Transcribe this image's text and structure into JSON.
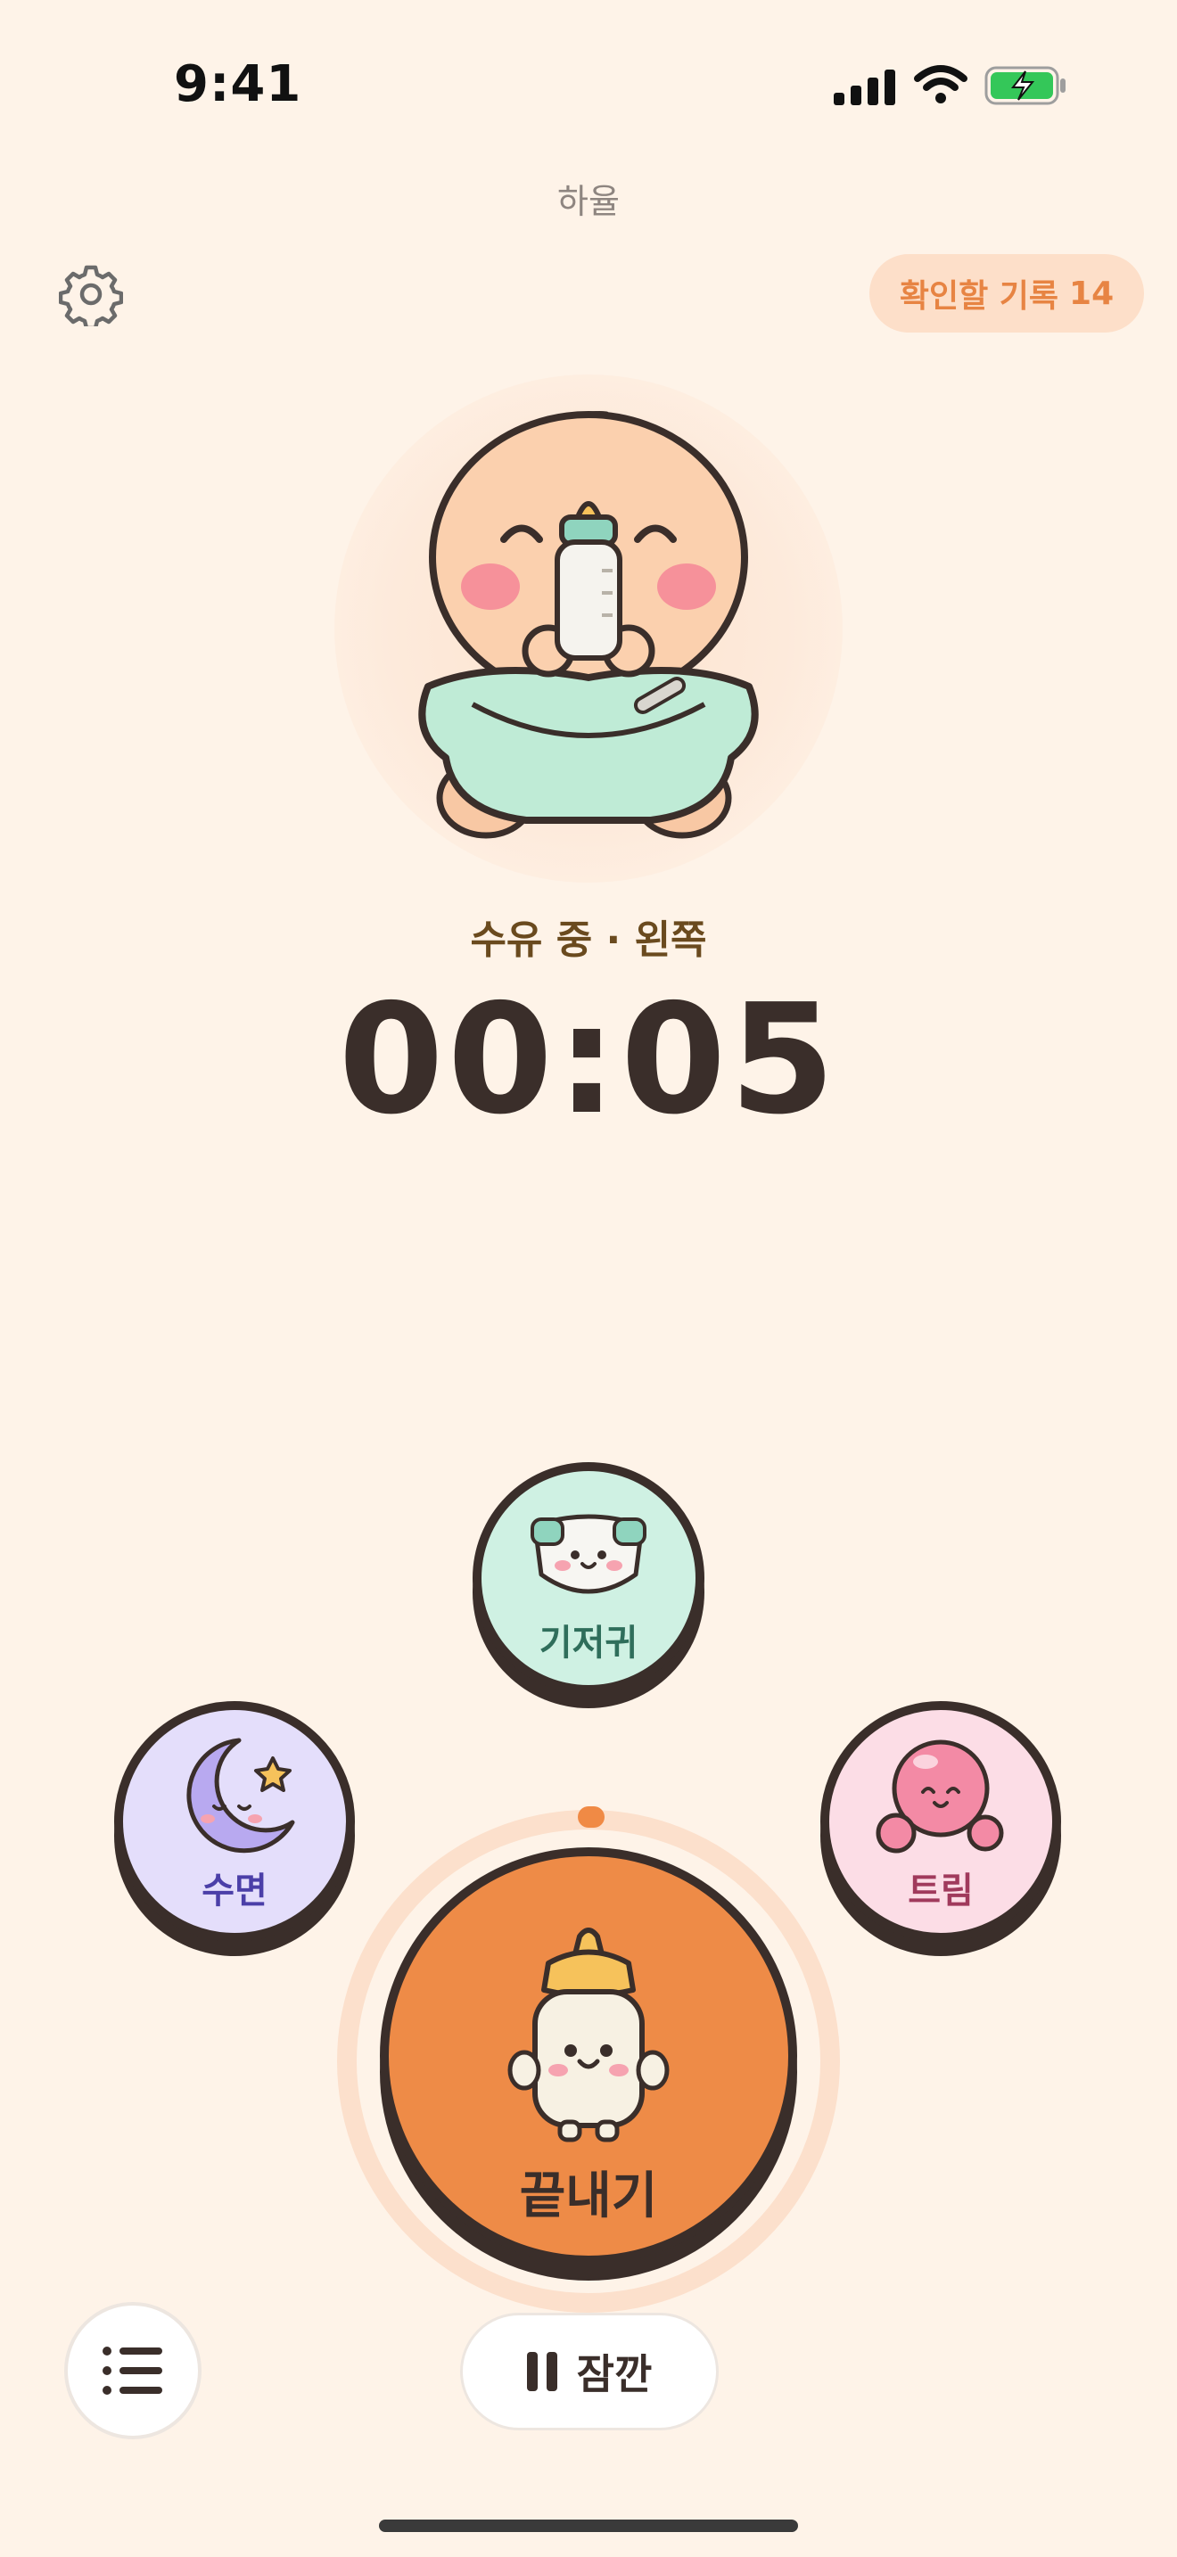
{
  "status_bar": {
    "time": "9:41"
  },
  "header": {
    "baby_name": "하율",
    "review_label": "확인할 기록",
    "review_count": "14"
  },
  "session": {
    "status": "수유 중 · 왼쪽",
    "timer": "00:05"
  },
  "actions": {
    "diaper": {
      "label": "기저귀",
      "icon": "diaper-icon"
    },
    "sleep": {
      "label": "수면",
      "icon": "moon-icon"
    },
    "burp": {
      "label": "트림",
      "icon": "bubble-icon"
    },
    "finish": {
      "label": "끝내기",
      "icon": "bottle-icon"
    }
  },
  "bottom": {
    "pause_label": "잠깐"
  },
  "colors": {
    "background": "#FEF3E8",
    "accent": "#EE8B47",
    "diaper": "#CFF1E3",
    "sleep": "#E4DEFB",
    "burp": "#FCDDE6",
    "outline": "#3A2E2A"
  }
}
